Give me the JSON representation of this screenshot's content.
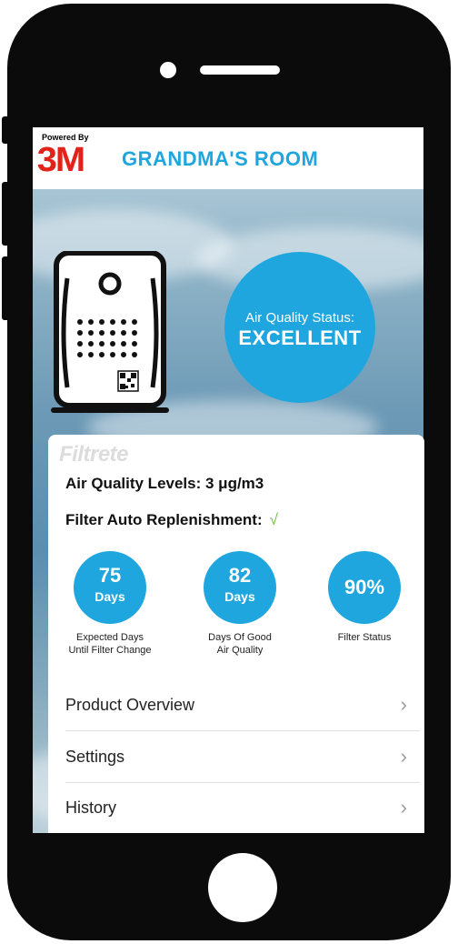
{
  "header": {
    "powered_by": "Powered By",
    "brand_logo": "3M",
    "room_title": "GRANDMA'S ROOM"
  },
  "status": {
    "label": "Air Quality Status:",
    "value": "EXCELLENT"
  },
  "card": {
    "brand": "Filtrete",
    "air_quality_levels": "Air Quality Levels: 3 μg/m3",
    "auto_replenishment": "Filter Auto Replenishment:",
    "auto_replenishment_icon": "checkmark-icon",
    "check_glyph": "√",
    "stats": [
      {
        "value": "75",
        "unit": "Days",
        "caption_line1": "Expected Days",
        "caption_line2": "Until Filter Change"
      },
      {
        "value": "82",
        "unit": "Days",
        "caption_line1": "Days Of Good",
        "caption_line2": "Air Quality"
      },
      {
        "value": "90%",
        "unit": "",
        "caption_line1": "Filter Status",
        "caption_line2": ""
      }
    ],
    "menu": [
      {
        "label": "Product Overview"
      },
      {
        "label": "Settings"
      },
      {
        "label": "History"
      }
    ],
    "chevron_glyph": "›"
  },
  "colors": {
    "accent": "#1fa6de",
    "brand_red": "#e2231a",
    "check_green": "#6cc04a"
  }
}
